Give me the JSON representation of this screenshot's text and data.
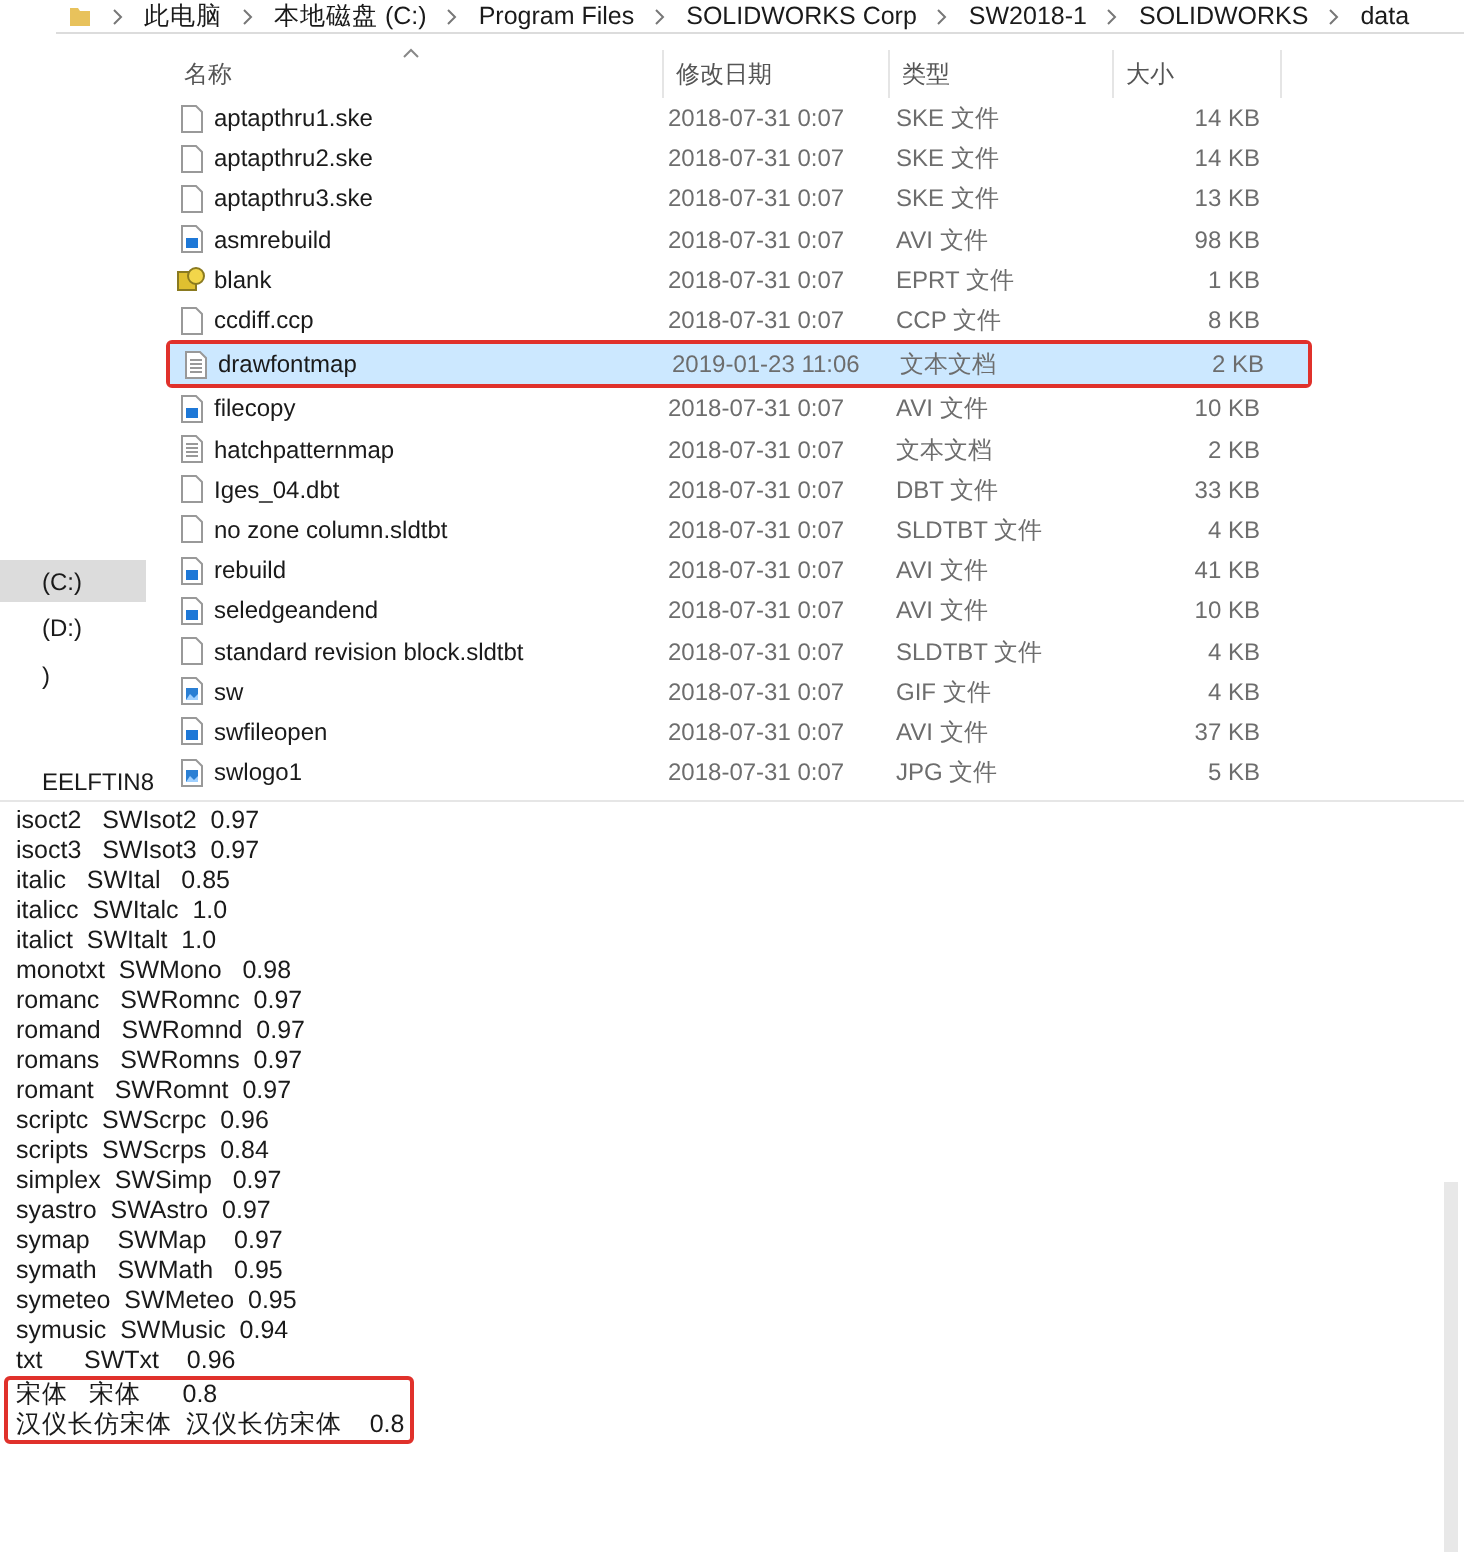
{
  "breadcrumb": [
    "此电脑",
    "本地磁盘 (C:)",
    "Program Files",
    "SOLIDWORKS Corp",
    "SW2018-1",
    "SOLIDWORKS",
    "data"
  ],
  "navigation": [
    {
      "label": "(C:)",
      "selected": true
    },
    {
      "label": "(D:)",
      "selected": false
    },
    {
      "label": ")",
      "selected": false
    },
    {
      "label": "EELFTIN8",
      "selected": false
    }
  ],
  "columns": [
    "名称",
    "修改日期",
    "类型",
    "大小"
  ],
  "files": [
    {
      "kind": "file",
      "name": "aptapthru1.ske",
      "modified": "2018-07-31 0:07",
      "type": "SKE 文件",
      "size": "14 KB",
      "selected": false,
      "outlined": false
    },
    {
      "kind": "file",
      "name": "aptapthru2.ske",
      "modified": "2018-07-31 0:07",
      "type": "SKE 文件",
      "size": "14 KB",
      "selected": false,
      "outlined": false
    },
    {
      "kind": "file",
      "name": "aptapthru3.ske",
      "modified": "2018-07-31 0:07",
      "type": "SKE 文件",
      "size": "13 KB",
      "selected": false,
      "outlined": false
    },
    {
      "kind": "video",
      "name": "asmrebuild",
      "modified": "2018-07-31 0:07",
      "type": "AVI 文件",
      "size": "98 KB",
      "selected": false,
      "outlined": false
    },
    {
      "kind": "part",
      "name": "blank",
      "modified": "2018-07-31 0:07",
      "type": "EPRT 文件",
      "size": "1 KB",
      "selected": false,
      "outlined": false
    },
    {
      "kind": "file",
      "name": "ccdiff.ccp",
      "modified": "2018-07-31 0:07",
      "type": "CCP 文件",
      "size": "8 KB",
      "selected": false,
      "outlined": false
    },
    {
      "kind": "text",
      "name": "drawfontmap",
      "modified": "2019-01-23 11:06",
      "type": "文本文档",
      "size": "2 KB",
      "selected": true,
      "outlined": true
    },
    {
      "kind": "video",
      "name": "filecopy",
      "modified": "2018-07-31 0:07",
      "type": "AVI 文件",
      "size": "10 KB",
      "selected": false,
      "outlined": false
    },
    {
      "kind": "text",
      "name": "hatchpatternmap",
      "modified": "2018-07-31 0:07",
      "type": "文本文档",
      "size": "2 KB",
      "selected": false,
      "outlined": false
    },
    {
      "kind": "file",
      "name": "Iges_04.dbt",
      "modified": "2018-07-31 0:07",
      "type": "DBT 文件",
      "size": "33 KB",
      "selected": false,
      "outlined": false
    },
    {
      "kind": "file",
      "name": "no zone column.sldtbt",
      "modified": "2018-07-31 0:07",
      "type": "SLDTBT 文件",
      "size": "4 KB",
      "selected": false,
      "outlined": false
    },
    {
      "kind": "video",
      "name": "rebuild",
      "modified": "2018-07-31 0:07",
      "type": "AVI 文件",
      "size": "41 KB",
      "selected": false,
      "outlined": false
    },
    {
      "kind": "video",
      "name": "seledgeandend",
      "modified": "2018-07-31 0:07",
      "type": "AVI 文件",
      "size": "10 KB",
      "selected": false,
      "outlined": false
    },
    {
      "kind": "file",
      "name": "standard revision block.sldtbt",
      "modified": "2018-07-31 0:07",
      "type": "SLDTBT 文件",
      "size": "4 KB",
      "selected": false,
      "outlined": false
    },
    {
      "kind": "image",
      "name": "sw",
      "modified": "2018-07-31 0:07",
      "type": "GIF 文件",
      "size": "4 KB",
      "selected": false,
      "outlined": false
    },
    {
      "kind": "video",
      "name": "swfileopen",
      "modified": "2018-07-31 0:07",
      "type": "AVI 文件",
      "size": "37 KB",
      "selected": false,
      "outlined": false
    },
    {
      "kind": "image",
      "name": "swlogo1",
      "modified": "2018-07-31 0:07",
      "type": "JPG 文件",
      "size": "5 KB",
      "selected": false,
      "outlined": false
    }
  ],
  "editor_lines": [
    {
      "text": "isoct2   SWIsot2  0.97",
      "outlined": false
    },
    {
      "text": "isoct3   SWIsot3  0.97",
      "outlined": false
    },
    {
      "text": "italic   SWItal   0.85",
      "outlined": false
    },
    {
      "text": "italicc  SWItalc  1.0",
      "outlined": false
    },
    {
      "text": "italict  SWItalt  1.0",
      "outlined": false
    },
    {
      "text": "monotxt  SWMono   0.98",
      "outlined": false
    },
    {
      "text": "romanc   SWRomnc  0.97",
      "outlined": false
    },
    {
      "text": "romand   SWRomnd  0.97",
      "outlined": false
    },
    {
      "text": "romans   SWRomns  0.97",
      "outlined": false
    },
    {
      "text": "romant   SWRomnt  0.97",
      "outlined": false
    },
    {
      "text": "scriptc  SWScrpc  0.96",
      "outlined": false
    },
    {
      "text": "scripts  SWScrps  0.84",
      "outlined": false
    },
    {
      "text": "simplex  SWSimp   0.97",
      "outlined": false
    },
    {
      "text": "syastro  SWAstro  0.97",
      "outlined": false
    },
    {
      "text": "symap    SWMap    0.97",
      "outlined": false
    },
    {
      "text": "symath   SWMath   0.95",
      "outlined": false
    },
    {
      "text": "symeteo  SWMeteo  0.95",
      "outlined": false
    },
    {
      "text": "symusic  SWMusic  0.94",
      "outlined": false
    },
    {
      "text": "txt      SWTxt    0.96",
      "outlined": false
    },
    {
      "text": "宋体   宋体      0.8",
      "outlined": true
    },
    {
      "text": "汉仪长仿宋体  汉仪长仿宋体    0.8",
      "outlined": true
    }
  ]
}
